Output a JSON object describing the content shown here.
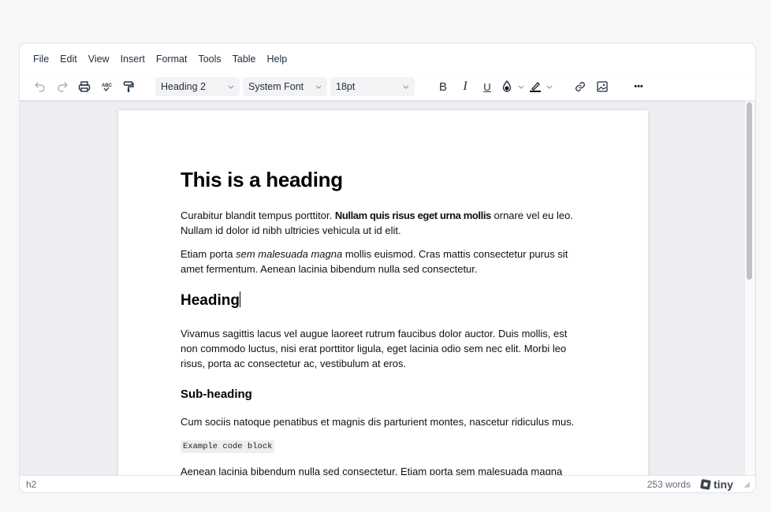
{
  "menubar": {
    "items": [
      "File",
      "Edit",
      "View",
      "Insert",
      "Format",
      "Tools",
      "Table",
      "Help"
    ]
  },
  "toolbar": {
    "icons": {
      "undo": "undo-icon",
      "redo": "redo-icon",
      "print": "print-icon",
      "spellcheck": "spellcheck-icon",
      "format_painter": "format-painter-icon",
      "bold": "B",
      "italic": "I",
      "underline": "U",
      "text_color": "text-color-icon",
      "highlight": "highlight-icon",
      "link": "link-icon",
      "image": "image-icon",
      "more": "•••"
    },
    "block_format": "Heading 2",
    "font_family": "System Font",
    "font_size": "18pt"
  },
  "document": {
    "h1": "This is a heading",
    "p1_start": "Curabitur blandit tempus porttitor. ",
    "p1_bold": "Nullam quis risus eget urna mollis",
    "p1_end": " ornare vel eu leo. Nullam id dolor id nibh ultricies vehicula ut id elit.",
    "p2_start": "Etiam porta ",
    "p2_italic": "sem malesuada magna",
    "p2_end": " mollis euismod. Cras mattis consectetur purus sit amet fermentum. Aenean lacinia bibendum nulla sed consectetur.",
    "h2": "Heading",
    "p3": "Vivamus sagittis lacus vel augue laoreet rutrum faucibus dolor auctor. Duis mollis, est non commodo luctus, nisi erat porttitor ligula, eget lacinia odio sem nec elit. Morbi leo risus, porta ac consectetur ac, vestibulum at eros.",
    "h3": "Sub-heading",
    "p4": "Cum sociis natoque penatibus et magnis dis parturient montes, nascetur ridiculus mus.",
    "code": "Example code block",
    "p5_partial": "Aenean lacinia bibendum nulla sed consectetur. Etiam porta sem malesuada magna"
  },
  "statusbar": {
    "path": "h2",
    "word_count": "253 words",
    "brand": "tiny"
  }
}
